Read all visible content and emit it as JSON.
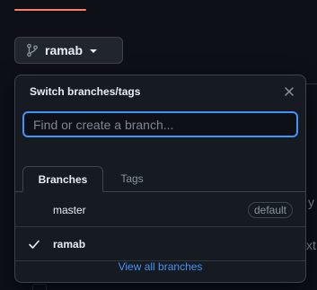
{
  "branch_button": {
    "label": "ramab",
    "icon": "git-branch-icon"
  },
  "popover": {
    "title": "Switch branches/tags",
    "close_icon": "x-icon",
    "search": {
      "placeholder": "Find or create a branch...",
      "value": ""
    },
    "tabs": [
      {
        "label": "Branches",
        "active": true
      },
      {
        "label": "Tags",
        "active": false
      }
    ],
    "branches": [
      {
        "name": "master",
        "badge": "default",
        "selected": false
      },
      {
        "name": "ramab",
        "badge": "",
        "selected": true
      }
    ],
    "view_all_label": "View all branches"
  },
  "background": {
    "fragments": [
      "y",
      "xt"
    ]
  },
  "colors": {
    "page_bg": "#0d1117",
    "popover_bg": "#161b22",
    "border": "#3d444d",
    "accent_blue": "#4493f8",
    "tab_accent": "#f78166",
    "text": "#e6edf3",
    "muted": "#8b949e"
  }
}
